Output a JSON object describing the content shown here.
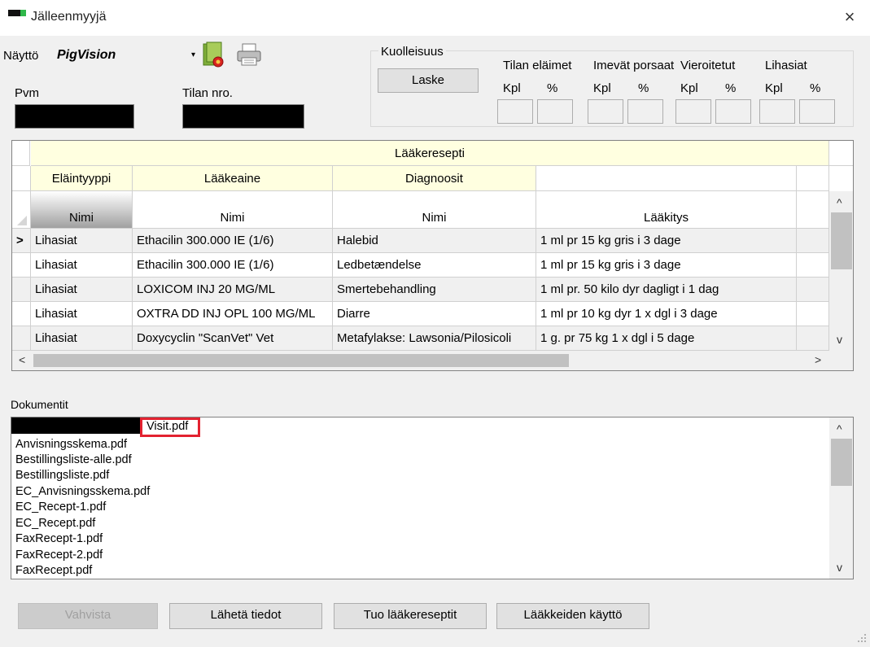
{
  "window": {
    "title": "Jälleenmyyjä"
  },
  "toolbar": {
    "naytto_label": "Näyttö",
    "naytto_value": "PigVision"
  },
  "fields": {
    "pvm_label": "Pvm",
    "tilan_label": "Tilan nro."
  },
  "mortality": {
    "title": "Kuolleisuus",
    "button": "Laske",
    "groups": [
      {
        "title": "Tilan eläimet",
        "kpl": "Kpl",
        "pct": "%"
      },
      {
        "title": "Imevät porsaat",
        "kpl": "Kpl",
        "pct": "%"
      },
      {
        "title": "Vieroitetut",
        "kpl": "Kpl",
        "pct": "%"
      },
      {
        "title": "Lihasiat",
        "kpl": "Kpl",
        "pct": "%"
      }
    ]
  },
  "grid": {
    "band_title": "Lääkeresepti",
    "group_headers": [
      "Eläintyyppi",
      "Lääkeaine",
      "Diagnoosit"
    ],
    "columns": [
      "Nimi",
      "Nimi",
      "Nimi",
      "Lääkitys"
    ],
    "current_row_marker": ">",
    "rows": [
      [
        "Lihasiat",
        "Ethacilin 300.000 IE (1/6)",
        "Halebid",
        "1 ml pr 15 kg gris i 3 dage"
      ],
      [
        "Lihasiat",
        "Ethacilin 300.000 IE (1/6)",
        "Ledbetændelse",
        "1 ml pr 15 kg gris i 3 dage"
      ],
      [
        "Lihasiat",
        "LOXICOM INJ 20 MG/ML",
        "Smertebehandling",
        "1 ml pr. 50 kilo dyr dagligt i 1 dag"
      ],
      [
        "Lihasiat",
        "OXTRA DD INJ OPL 100 MG/ML",
        "Diarre",
        "1 ml pr 10 kg dyr 1 x dgl i 3 dage"
      ],
      [
        "Lihasiat",
        "Doxycyclin \"ScanVet\" Vet",
        "Metafylakse: Lawsonia/Pilosicoli",
        "1 g. pr 75 kg 1 x dgl i 5 dage"
      ]
    ]
  },
  "documents": {
    "label": "Dokumentit",
    "first_item_suffix": "Visit.pdf",
    "items": [
      "Anvisningsskema.pdf",
      "Bestillingsliste-alle.pdf",
      "Bestillingsliste.pdf",
      "EC_Anvisningsskema.pdf",
      "EC_Recept-1.pdf",
      "EC_Recept.pdf",
      "FaxRecept-1.pdf",
      "FaxRecept-2.pdf",
      "FaxRecept.pdf"
    ]
  },
  "buttons": {
    "vahvista": "Vahvista",
    "laheta": "Lähetä tiedot",
    "tuo": "Tuo lääkereseptit",
    "laakkeiden": "Lääkkeiden käyttö"
  },
  "icons": {
    "close": "×",
    "dropdown": "▾",
    "scroll_up": "^",
    "scroll_down": "v",
    "scroll_left": "<",
    "scroll_right": ">"
  }
}
